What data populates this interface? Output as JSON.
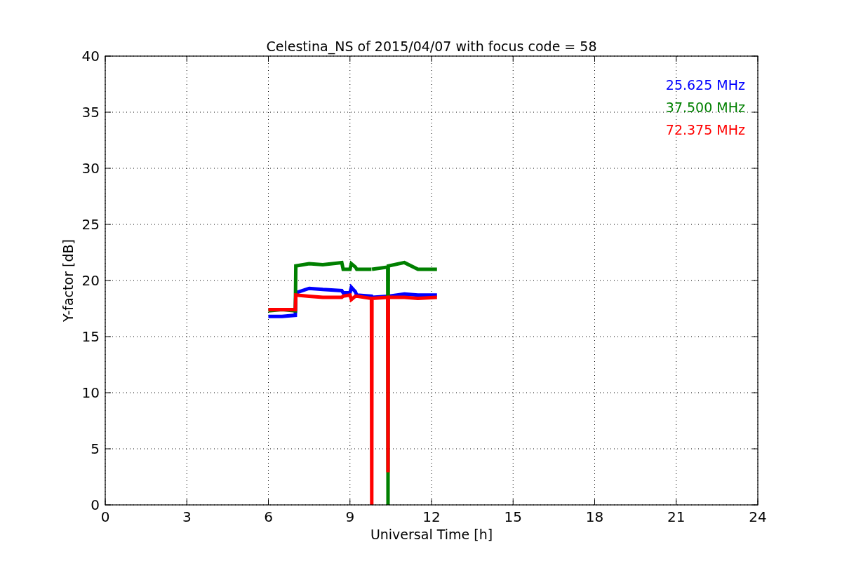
{
  "chart_data": {
    "type": "line",
    "title": "Celestina_NS of 2015/04/07 with focus code = 58",
    "xlabel": "Universal Time [h]",
    "ylabel": "Y-factor [dB]",
    "x": [
      6,
      6.5,
      6.99,
      7.01,
      7.5,
      8,
      8.7,
      8.75,
      9.0,
      9.05,
      9.2,
      9.25,
      9.79,
      9.8,
      9.81,
      10.39,
      10.4,
      10.41,
      11,
      11.5,
      12.2
    ],
    "series": [
      {
        "name": "25.625 MHz",
        "color": "#0000ff",
        "values": [
          16.8,
          16.8,
          16.9,
          18.9,
          19.3,
          19.2,
          19.1,
          18.9,
          18.9,
          19.4,
          19.0,
          18.7,
          18.6,
          18.5,
          18.5,
          18.6,
          18.6,
          18.6,
          18.8,
          18.7,
          18.7
        ]
      },
      {
        "name": "37.500 MHz",
        "color": "#008000",
        "values": [
          17.3,
          17.4,
          17.3,
          21.3,
          21.5,
          21.4,
          21.6,
          21.0,
          21.0,
          21.5,
          21.2,
          21.0,
          21.0,
          null,
          21.0,
          21.2,
          0,
          21.3,
          21.6,
          21.0,
          21.0
        ]
      },
      {
        "name": "72.375 MHz",
        "color": "#ff0000",
        "values": [
          17.4,
          17.4,
          17.4,
          18.7,
          18.6,
          18.5,
          18.5,
          18.6,
          18.7,
          18.3,
          18.6,
          18.6,
          18.4,
          0,
          18.4,
          18.5,
          2.9,
          18.5,
          18.5,
          18.4,
          18.5
        ]
      }
    ],
    "grid": true,
    "xlim": [
      0,
      24
    ],
    "ylim": [
      0,
      40
    ],
    "xticks": [
      0,
      3,
      6,
      9,
      12,
      15,
      18,
      21,
      24
    ],
    "yticks": [
      0,
      5,
      10,
      15,
      20,
      25,
      30,
      35,
      40
    ]
  }
}
